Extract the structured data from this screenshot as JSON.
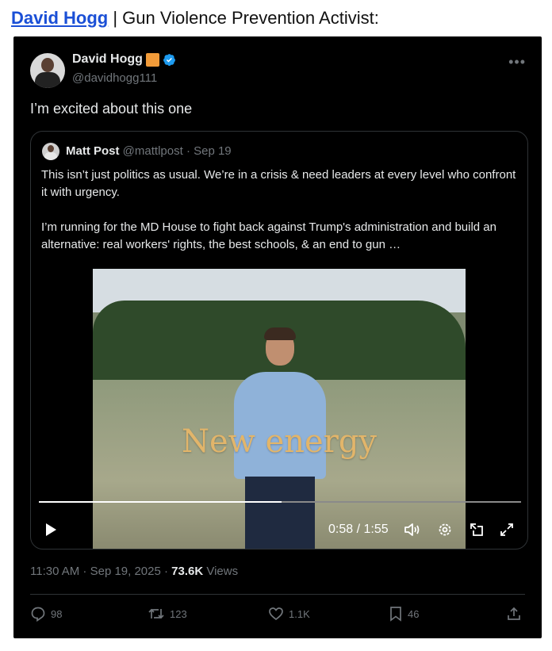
{
  "header": {
    "link_text": "David Hogg",
    "rest": " | Gun Violence Prevention Activist:"
  },
  "author": {
    "name": "David Hogg",
    "handle": "@davidhogg111"
  },
  "post": {
    "text": "I’m excited about this one"
  },
  "quote": {
    "name": "Matt Post",
    "handle": "@mattlpost",
    "date": "· Sep 19",
    "text": "This isn’t just politics as usual. We’re in a crisis & need  leaders at every level who confront it with urgency.\n\nI’m running for the MD House to fight back against Trump's administration and build an alternative: real workers' rights, the best schools, & an end to gun …",
    "video": {
      "overlay_text": "New energy",
      "time": "0:58 / 1:55",
      "progress": 0.503
    }
  },
  "meta": {
    "timestamp": "11:30 AM · Sep 19, 2025 · ",
    "views_count": "73.6K",
    "views_label": " Views"
  },
  "actions": {
    "replies": "98",
    "reposts": "123",
    "likes": "1.1K",
    "bookmarks": "46"
  },
  "colors": {
    "link": "#1a4fd6",
    "orange_badge": "#f29b39",
    "verified": "#1d9bf0",
    "overlay_text": "#e2b56a"
  }
}
